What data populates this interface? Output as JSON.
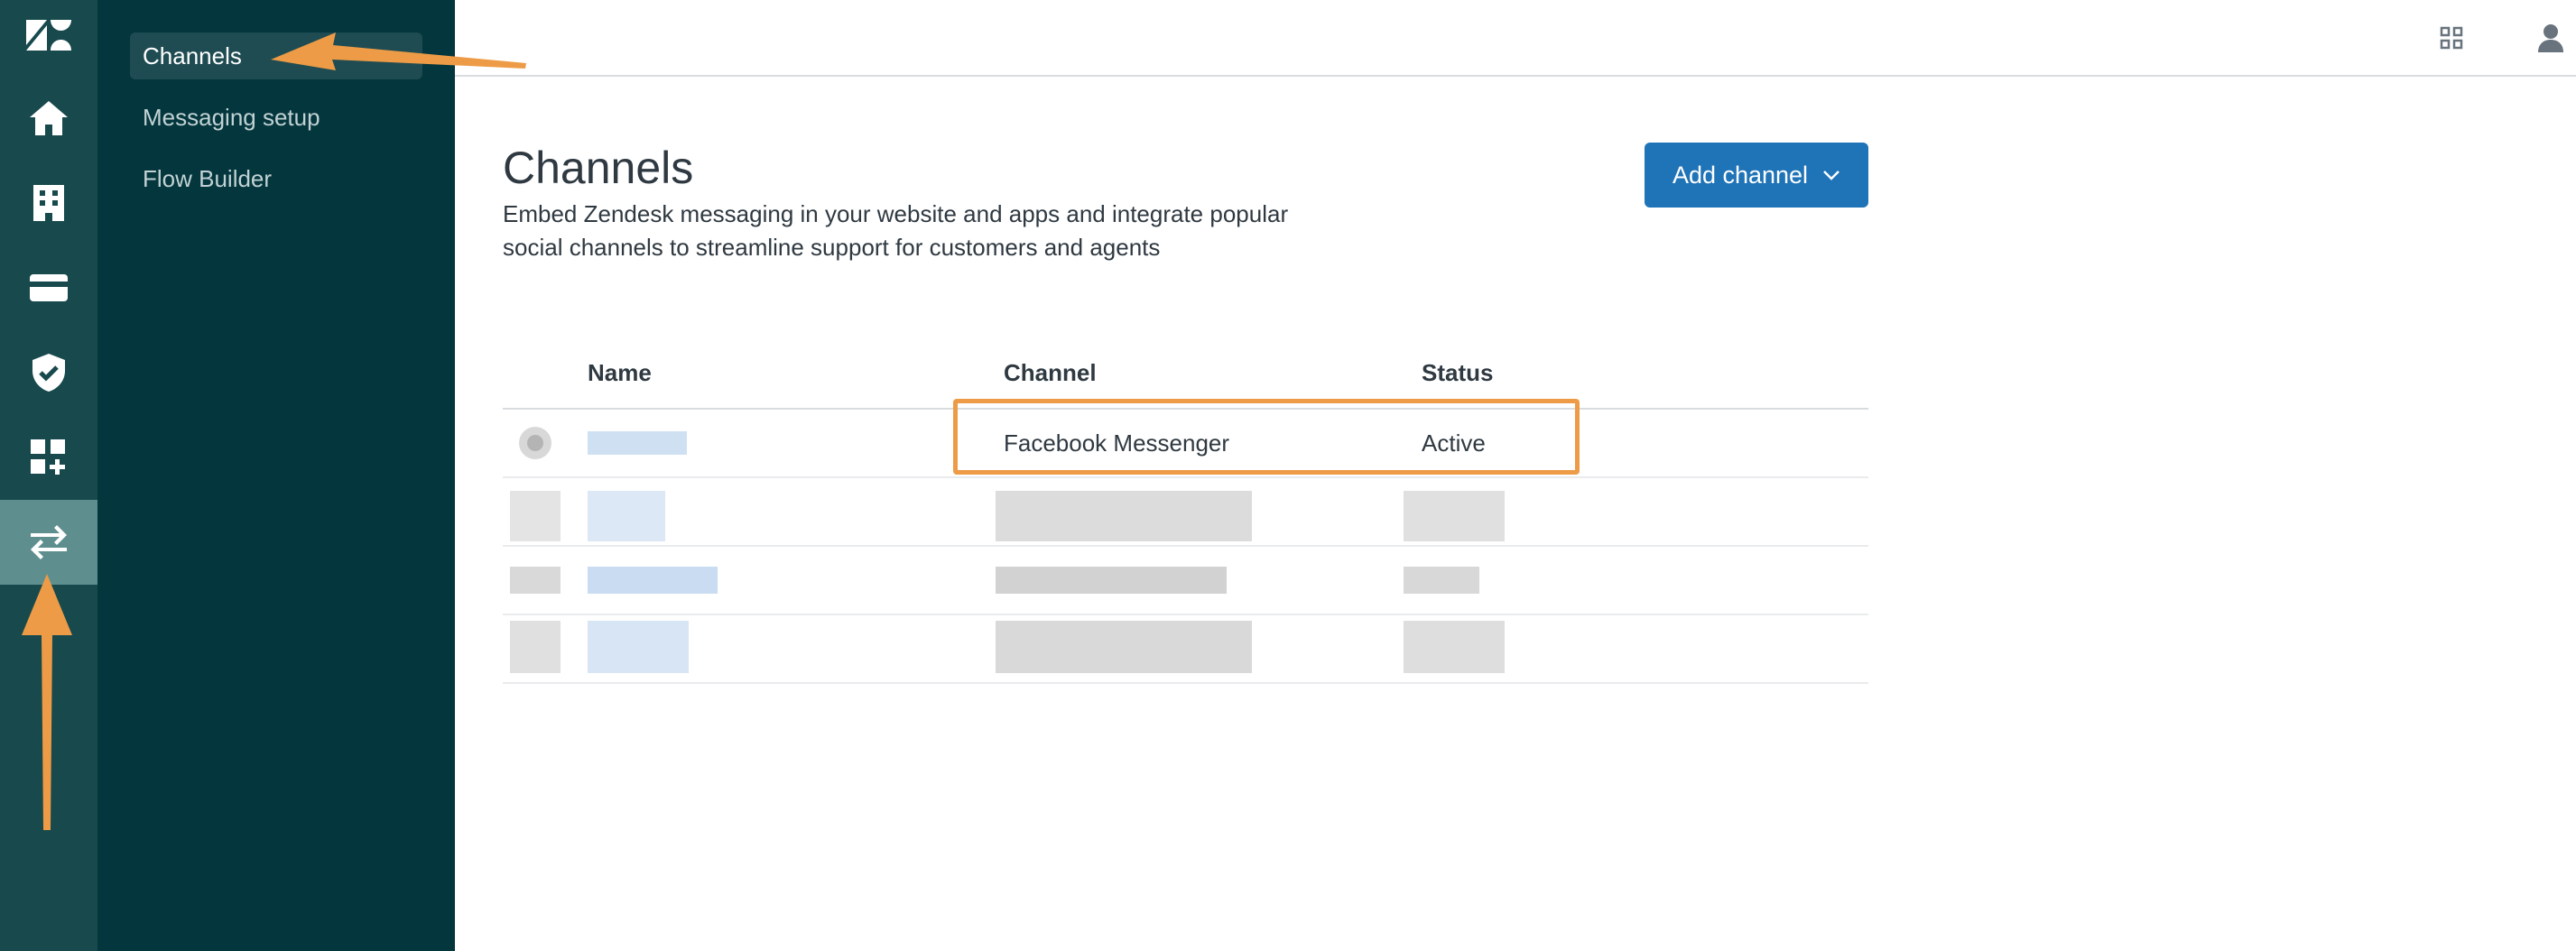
{
  "subnav": {
    "items": [
      {
        "label": "Channels"
      },
      {
        "label": "Messaging setup"
      },
      {
        "label": "Flow Builder"
      }
    ]
  },
  "page": {
    "title": "Channels",
    "description": "Embed Zendesk messaging in your website and apps and integrate popular social channels to streamline support for customers and agents",
    "add_button_label": "Add channel"
  },
  "table": {
    "headers": [
      "Name",
      "Channel",
      "Status"
    ],
    "rows": [
      {
        "channel": "Facebook Messenger",
        "status": "Active"
      }
    ]
  },
  "icons": {
    "rail": [
      "zendesk-logo-icon",
      "home-icon",
      "building-icon",
      "credit-card-icon",
      "shield-check-icon",
      "apps-add-icon",
      "channels-arrows-icon"
    ],
    "topbar": [
      "grid-icon",
      "user-icon"
    ]
  },
  "colors": {
    "rail_bg": "#17494d",
    "subnav_bg": "#03363d",
    "primary": "#1f73b7",
    "annotation": "#ed9b46"
  }
}
